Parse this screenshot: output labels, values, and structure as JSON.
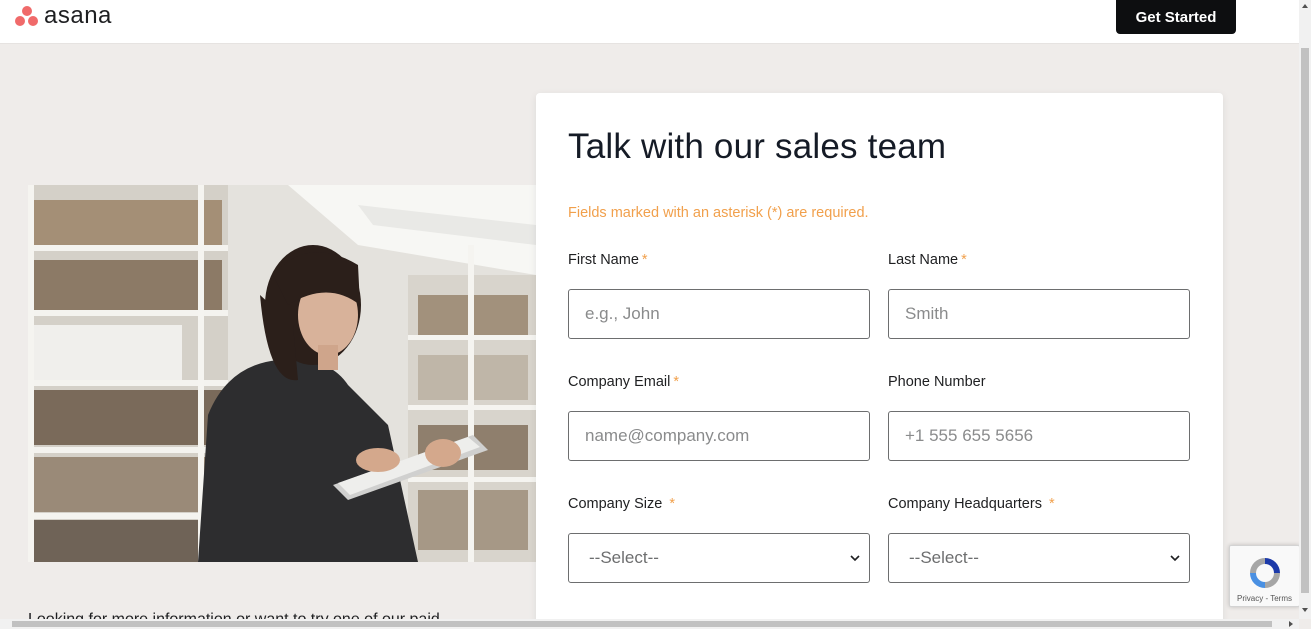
{
  "header": {
    "brand": "asana",
    "cta_label": "Get Started"
  },
  "intro_text": "Looking for more information or want to try one of our paid",
  "form": {
    "title": "Talk with our sales team",
    "required_note": "Fields marked with an asterisk (*) are required.",
    "first_name": {
      "label": "First Name",
      "required": "*",
      "placeholder": "e.g., John"
    },
    "last_name": {
      "label": "Last Name",
      "required": "*",
      "placeholder": "Smith"
    },
    "email": {
      "label": "Company Email",
      "required": "*",
      "placeholder": "name@company.com"
    },
    "phone": {
      "label": "Phone Number",
      "placeholder": "+1 555 655 5656"
    },
    "company_size": {
      "label": "Company Size",
      "required": "*",
      "selected": "--Select--"
    },
    "company_hq": {
      "label": "Company Headquarters",
      "required": "*",
      "selected": "--Select--"
    }
  },
  "recaptcha": {
    "links": "Privacy - Terms"
  },
  "colors": {
    "brand_coral": "#f06a6a",
    "required_orange": "#f1a04c",
    "cta_black": "#0d0e10",
    "page_bg": "#efecea"
  },
  "icons": {
    "logo": "asana-logo-icon",
    "select_chevron": "chevron-down-icon",
    "recaptcha": "recaptcha-icon"
  }
}
